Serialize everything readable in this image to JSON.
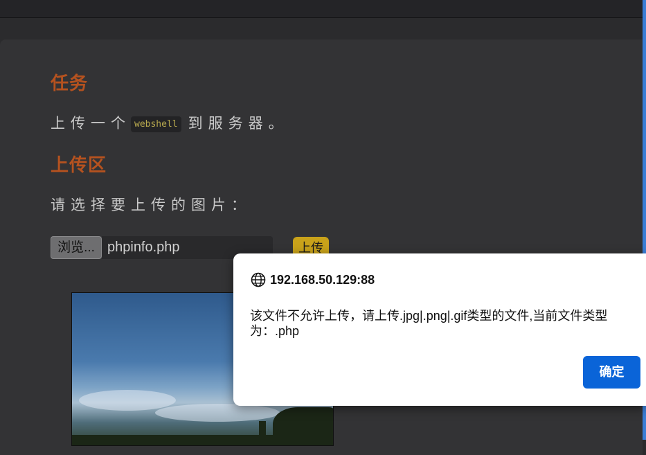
{
  "task": {
    "heading": "任务",
    "text_before": "上传一个",
    "code": "webshell",
    "text_after": "到服务器。"
  },
  "upload_area": {
    "heading": "上传区",
    "instruction": "请选择要上传的图片：",
    "browse_label": "浏览...",
    "file_name": "phpinfo.php",
    "upload_label": "上传"
  },
  "dialog": {
    "host": "192.168.50.129:88",
    "message": "该文件不允许上传，请上传.jpg|.png|.gif类型的文件,当前文件类型为：.php",
    "ok_label": "确定",
    "host_icon": "globe-icon"
  },
  "colors": {
    "heading": "#b5521f",
    "upload_button": "#c9a21a",
    "ok_button": "#0a64d8"
  }
}
